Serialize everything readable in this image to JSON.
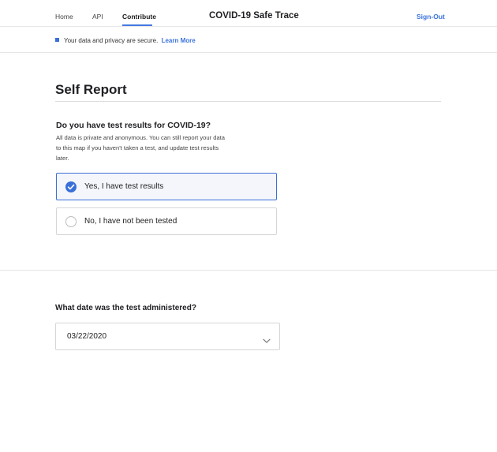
{
  "nav": {
    "home": "Home",
    "api": "API",
    "contribute": "Contribute",
    "app_title": "COVID-19 Safe Trace",
    "signout": "Sign-Out"
  },
  "privacy": {
    "text": "Your data and privacy are secure.",
    "link": "Learn More"
  },
  "page": {
    "title": "Self Report"
  },
  "test_question": {
    "title": "Do you have test results for COVID-19?",
    "description": "All data is private and anonymous. You can still report your data to this map if you haven't taken a test, and update test results later.",
    "options": [
      {
        "label": "Yes, I have test results",
        "selected": true
      },
      {
        "label": "No, I have not been tested",
        "selected": false
      }
    ]
  },
  "date_question": {
    "title": "What date was the test administered?",
    "value": "03/22/2020"
  },
  "colors": {
    "accent": "#3a6fd8",
    "link": "#3a72dc",
    "border": "#d6d6d6"
  }
}
